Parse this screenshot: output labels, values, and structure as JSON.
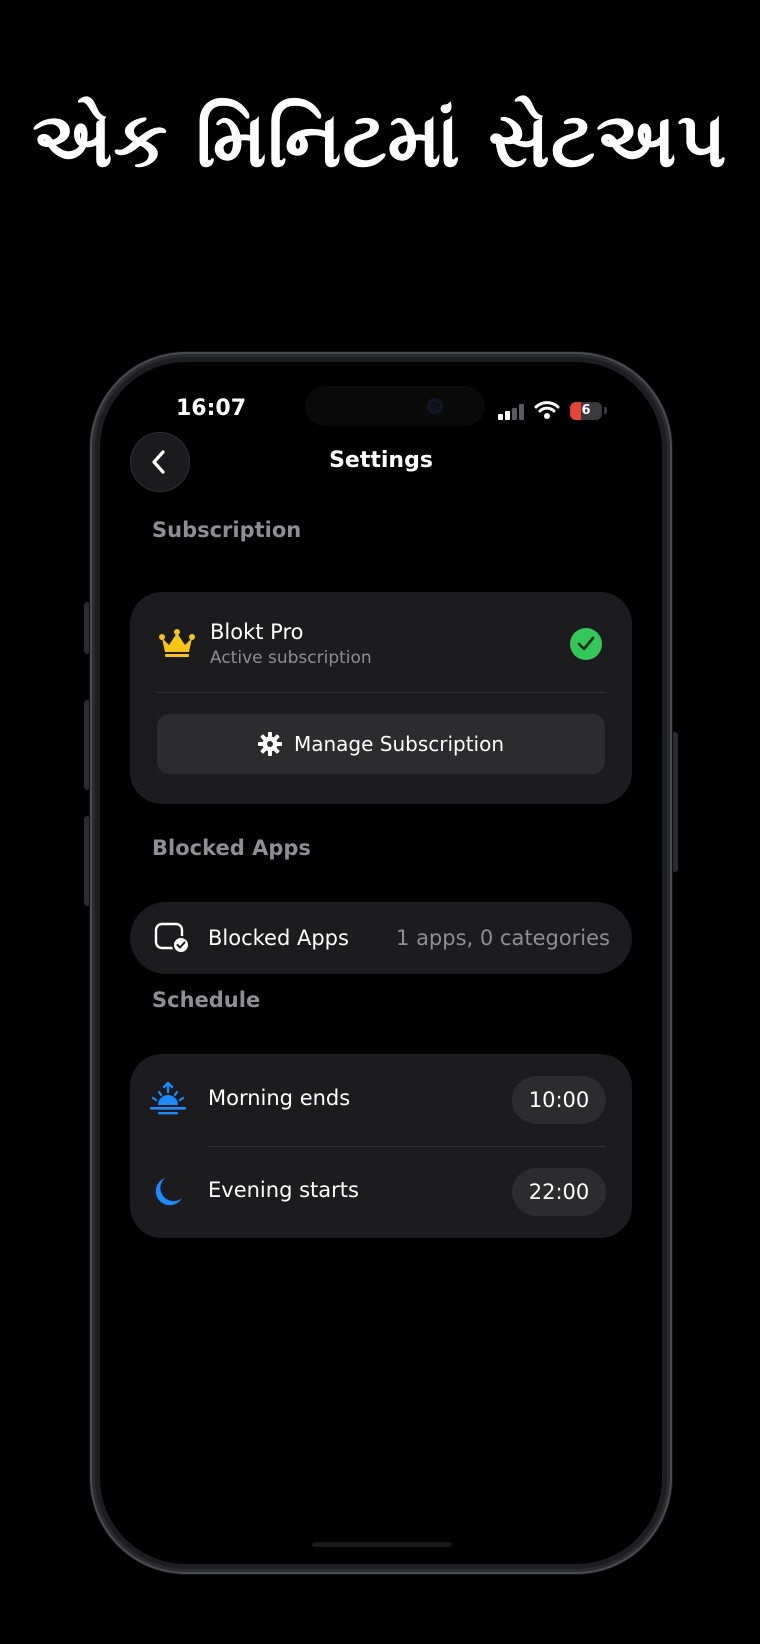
{
  "headline": "એક મિનિટમાં સેટઅપ",
  "status_bar": {
    "time": "16:07",
    "battery_level": "6",
    "battery_fraction": 0.06
  },
  "header": {
    "title": "Settings",
    "back_icon": "chevron-left-icon"
  },
  "subscription": {
    "section_label": "Subscription",
    "plan_name": "Blokt Pro",
    "plan_status": "Active subscription",
    "crown_color": "#f5c518",
    "status_color": "#34c759",
    "manage_label": "Manage Subscription",
    "manage_icon": "gear-icon"
  },
  "blocked_apps": {
    "section_label": "Blocked Apps",
    "row_label": "Blocked Apps",
    "row_value": "1 apps, 0 categories",
    "icon": "blocked-apps-icon"
  },
  "schedule": {
    "section_label": "Schedule",
    "accent_color": "#1a8cff",
    "items": [
      {
        "label": "Morning ends",
        "time": "10:00",
        "icon": "sunrise-icon"
      },
      {
        "label": "Evening starts",
        "time": "22:00",
        "icon": "moon-icon"
      }
    ]
  }
}
